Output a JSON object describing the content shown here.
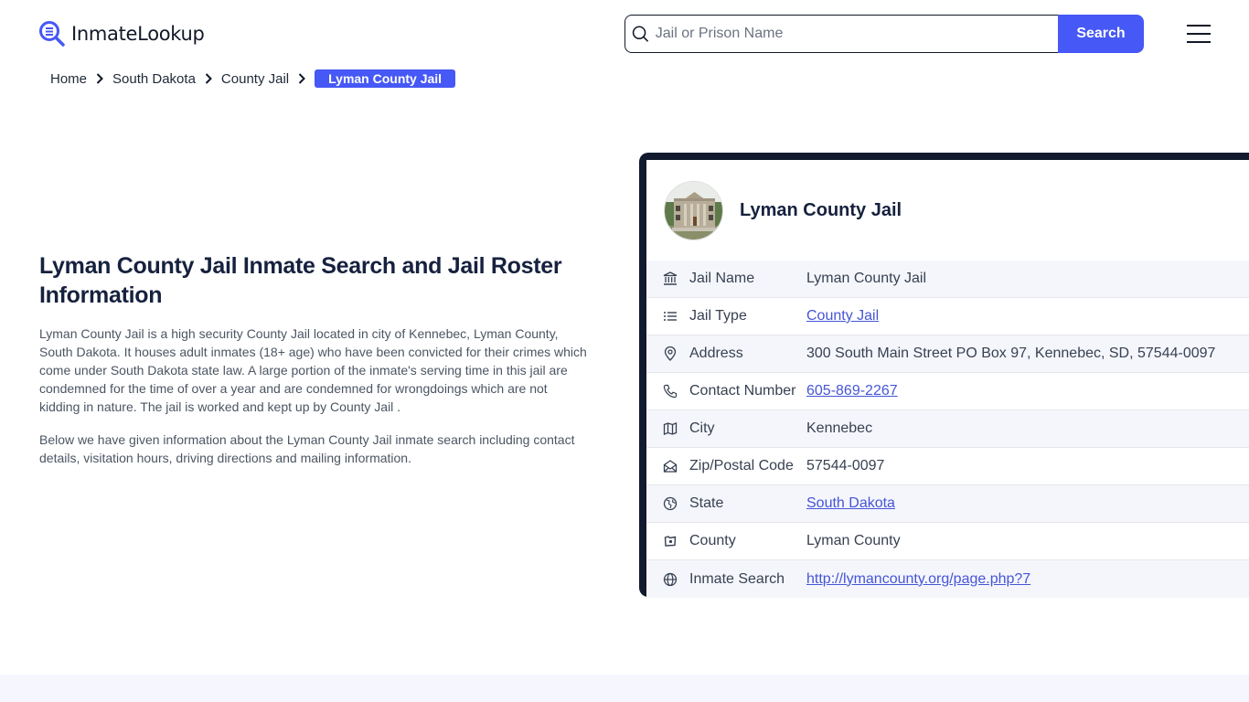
{
  "brand": {
    "name": "InmateLookup",
    "accent": "#4658f5"
  },
  "search": {
    "placeholder": "Jail or Prison Name",
    "value": "",
    "button_label": "Search"
  },
  "breadcrumb": [
    {
      "label": "Home"
    },
    {
      "label": "South Dakota"
    },
    {
      "label": "County Jail"
    },
    {
      "label": "Lyman County Jail",
      "active": true
    }
  ],
  "intro": {
    "title": "Lyman County Jail Inmate Search and Jail Roster Information",
    "paragraphs": [
      "Lyman County Jail is a high security County Jail located in city of Kennebec, Lyman County, South Dakota. It houses adult inmates (18+ age) who have been convicted for their crimes which come under South Dakota state law. A large portion of the inmate's serving time in this jail are condemned for the time of over a year and are condemned for wrongdoings which are not kidding in nature. The jail is worked and kept up by County Jail .",
      "Below we have given information about the Lyman County Jail inmate search including contact details, visitation hours, driving directions and mailing information."
    ]
  },
  "card": {
    "title": "Lyman County Jail",
    "rows": [
      {
        "icon": "building-columns-icon",
        "label": "Jail Name",
        "value": "Lyman County Jail",
        "link": false
      },
      {
        "icon": "list-icon",
        "label": "Jail Type",
        "value": "County Jail",
        "link": true
      },
      {
        "icon": "map-pin-icon",
        "label": "Address",
        "value": "300 South Main Street PO Box 97, Kennebec, SD, 57544-0097",
        "link": false
      },
      {
        "icon": "phone-icon",
        "label": "Contact Number",
        "value": "605-869-2267",
        "link": true
      },
      {
        "icon": "map-icon",
        "label": "City",
        "value": "Kennebec",
        "link": false
      },
      {
        "icon": "mail-open-icon",
        "label": "Zip/Postal Code",
        "value": "57544-0097",
        "link": false
      },
      {
        "icon": "globe-region-icon",
        "label": "State",
        "value": "South Dakota",
        "link": true
      },
      {
        "icon": "county-map-icon",
        "label": "County",
        "value": "Lyman County",
        "link": false
      },
      {
        "icon": "globe-icon",
        "label": "Inmate Search",
        "value": "http://lymancounty.org/page.php?7",
        "link": true
      }
    ]
  }
}
